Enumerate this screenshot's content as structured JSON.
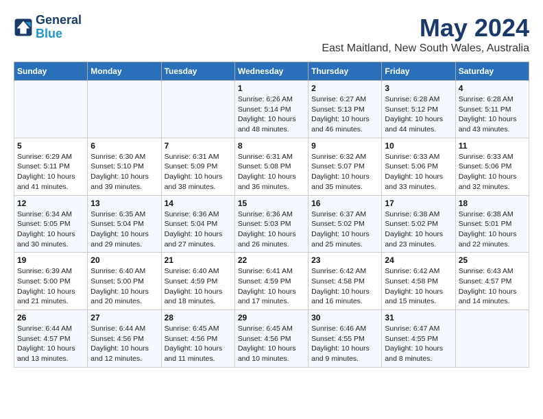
{
  "logo": {
    "line1": "General",
    "line2": "Blue"
  },
  "title": "May 2024",
  "subtitle": "East Maitland, New South Wales, Australia",
  "days_of_week": [
    "Sunday",
    "Monday",
    "Tuesday",
    "Wednesday",
    "Thursday",
    "Friday",
    "Saturday"
  ],
  "weeks": [
    [
      {
        "day": "",
        "info": ""
      },
      {
        "day": "",
        "info": ""
      },
      {
        "day": "",
        "info": ""
      },
      {
        "day": "1",
        "info": "Sunrise: 6:26 AM\nSunset: 5:14 PM\nDaylight: 10 hours\nand 48 minutes."
      },
      {
        "day": "2",
        "info": "Sunrise: 6:27 AM\nSunset: 5:13 PM\nDaylight: 10 hours\nand 46 minutes."
      },
      {
        "day": "3",
        "info": "Sunrise: 6:28 AM\nSunset: 5:12 PM\nDaylight: 10 hours\nand 44 minutes."
      },
      {
        "day": "4",
        "info": "Sunrise: 6:28 AM\nSunset: 5:11 PM\nDaylight: 10 hours\nand 43 minutes."
      }
    ],
    [
      {
        "day": "5",
        "info": "Sunrise: 6:29 AM\nSunset: 5:11 PM\nDaylight: 10 hours\nand 41 minutes."
      },
      {
        "day": "6",
        "info": "Sunrise: 6:30 AM\nSunset: 5:10 PM\nDaylight: 10 hours\nand 39 minutes."
      },
      {
        "day": "7",
        "info": "Sunrise: 6:31 AM\nSunset: 5:09 PM\nDaylight: 10 hours\nand 38 minutes."
      },
      {
        "day": "8",
        "info": "Sunrise: 6:31 AM\nSunset: 5:08 PM\nDaylight: 10 hours\nand 36 minutes."
      },
      {
        "day": "9",
        "info": "Sunrise: 6:32 AM\nSunset: 5:07 PM\nDaylight: 10 hours\nand 35 minutes."
      },
      {
        "day": "10",
        "info": "Sunrise: 6:33 AM\nSunset: 5:06 PM\nDaylight: 10 hours\nand 33 minutes."
      },
      {
        "day": "11",
        "info": "Sunrise: 6:33 AM\nSunset: 5:06 PM\nDaylight: 10 hours\nand 32 minutes."
      }
    ],
    [
      {
        "day": "12",
        "info": "Sunrise: 6:34 AM\nSunset: 5:05 PM\nDaylight: 10 hours\nand 30 minutes."
      },
      {
        "day": "13",
        "info": "Sunrise: 6:35 AM\nSunset: 5:04 PM\nDaylight: 10 hours\nand 29 minutes."
      },
      {
        "day": "14",
        "info": "Sunrise: 6:36 AM\nSunset: 5:04 PM\nDaylight: 10 hours\nand 27 minutes."
      },
      {
        "day": "15",
        "info": "Sunrise: 6:36 AM\nSunset: 5:03 PM\nDaylight: 10 hours\nand 26 minutes."
      },
      {
        "day": "16",
        "info": "Sunrise: 6:37 AM\nSunset: 5:02 PM\nDaylight: 10 hours\nand 25 minutes."
      },
      {
        "day": "17",
        "info": "Sunrise: 6:38 AM\nSunset: 5:02 PM\nDaylight: 10 hours\nand 23 minutes."
      },
      {
        "day": "18",
        "info": "Sunrise: 6:38 AM\nSunset: 5:01 PM\nDaylight: 10 hours\nand 22 minutes."
      }
    ],
    [
      {
        "day": "19",
        "info": "Sunrise: 6:39 AM\nSunset: 5:00 PM\nDaylight: 10 hours\nand 21 minutes."
      },
      {
        "day": "20",
        "info": "Sunrise: 6:40 AM\nSunset: 5:00 PM\nDaylight: 10 hours\nand 20 minutes."
      },
      {
        "day": "21",
        "info": "Sunrise: 6:40 AM\nSunset: 4:59 PM\nDaylight: 10 hours\nand 18 minutes."
      },
      {
        "day": "22",
        "info": "Sunrise: 6:41 AM\nSunset: 4:59 PM\nDaylight: 10 hours\nand 17 minutes."
      },
      {
        "day": "23",
        "info": "Sunrise: 6:42 AM\nSunset: 4:58 PM\nDaylight: 10 hours\nand 16 minutes."
      },
      {
        "day": "24",
        "info": "Sunrise: 6:42 AM\nSunset: 4:58 PM\nDaylight: 10 hours\nand 15 minutes."
      },
      {
        "day": "25",
        "info": "Sunrise: 6:43 AM\nSunset: 4:57 PM\nDaylight: 10 hours\nand 14 minutes."
      }
    ],
    [
      {
        "day": "26",
        "info": "Sunrise: 6:44 AM\nSunset: 4:57 PM\nDaylight: 10 hours\nand 13 minutes."
      },
      {
        "day": "27",
        "info": "Sunrise: 6:44 AM\nSunset: 4:56 PM\nDaylight: 10 hours\nand 12 minutes."
      },
      {
        "day": "28",
        "info": "Sunrise: 6:45 AM\nSunset: 4:56 PM\nDaylight: 10 hours\nand 11 minutes."
      },
      {
        "day": "29",
        "info": "Sunrise: 6:45 AM\nSunset: 4:56 PM\nDaylight: 10 hours\nand 10 minutes."
      },
      {
        "day": "30",
        "info": "Sunrise: 6:46 AM\nSunset: 4:55 PM\nDaylight: 10 hours\nand 9 minutes."
      },
      {
        "day": "31",
        "info": "Sunrise: 6:47 AM\nSunset: 4:55 PM\nDaylight: 10 hours\nand 8 minutes."
      },
      {
        "day": "",
        "info": ""
      }
    ]
  ]
}
